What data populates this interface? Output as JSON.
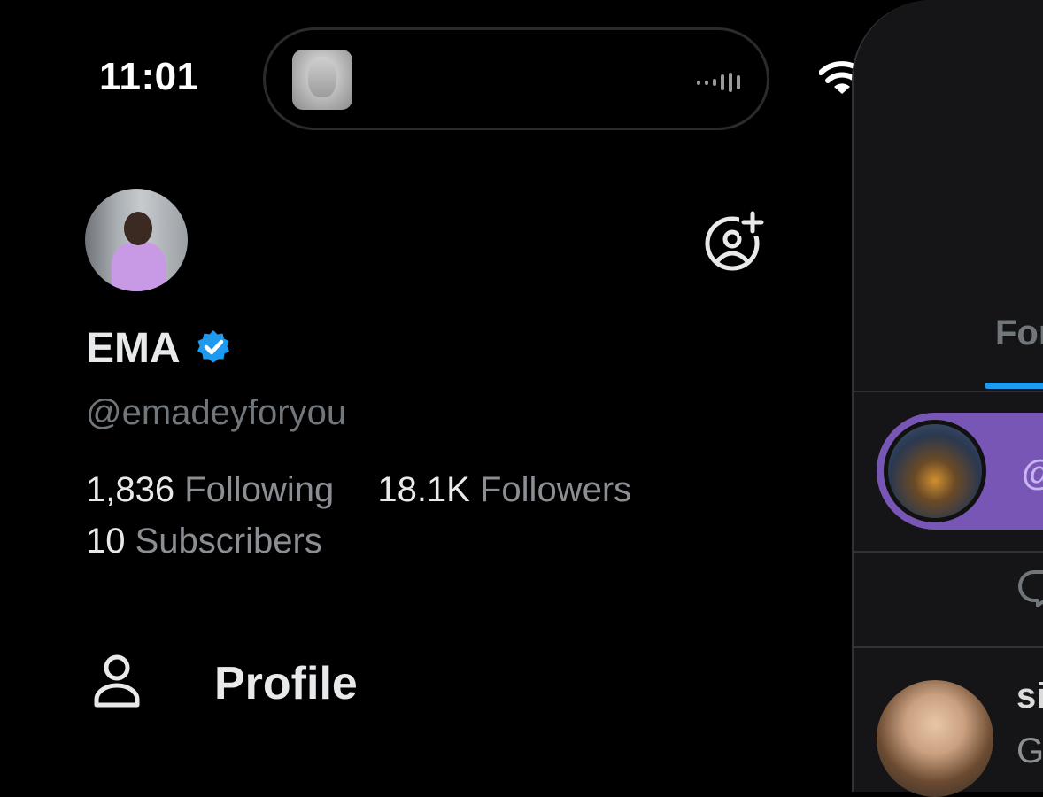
{
  "status_bar": {
    "time": "11:01"
  },
  "profile": {
    "display_name": "EMA",
    "handle": "@emadeyforyou",
    "following_count": "1,836",
    "following_label": "Following",
    "followers_count": "18.1K",
    "followers_label": "Followers",
    "subscribers_count": "10",
    "subscribers_label": "Subscribers"
  },
  "menu": {
    "items": [
      {
        "label": "Profile",
        "icon": "person-icon"
      }
    ]
  },
  "right_panel": {
    "tab_label": "For",
    "at_text": "@",
    "user_name_fragment": "si",
    "text_fragment": "G"
  },
  "colors": {
    "verified": "#1d9bf0",
    "accent_tab": "#1d9bf0",
    "pill": "#7856b5"
  }
}
